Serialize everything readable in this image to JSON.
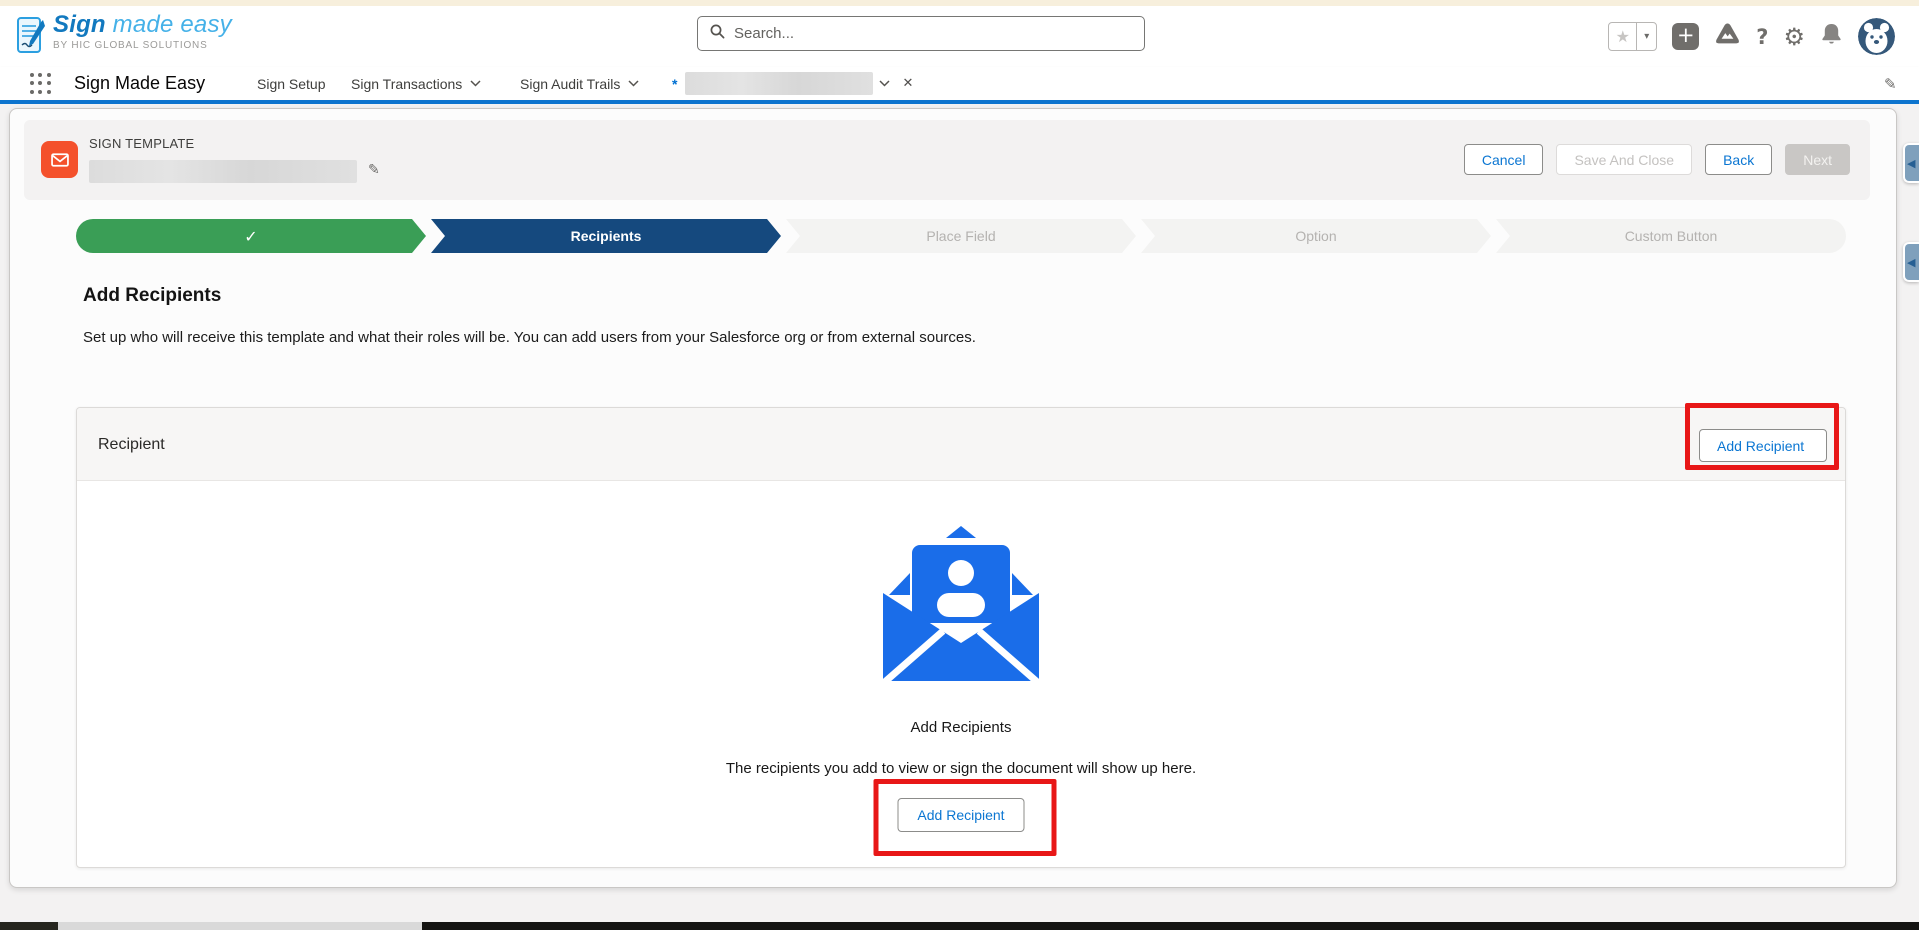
{
  "app": {
    "brand_bold": "Sign",
    "brand_light": " made easy",
    "brand_subtitle": "BY HIC GLOBAL SOLUTIONS",
    "app_name": "Sign Made Easy"
  },
  "header": {
    "search_placeholder": "Search..."
  },
  "glyphs": {
    "check": "✓",
    "star": "★",
    "caret_down": "▾",
    "plus": "+",
    "help": "?",
    "gear": "⚙",
    "close": "✕",
    "pencil": "✎",
    "toggle_left": "◀"
  },
  "nav": {
    "tabs": [
      {
        "label": "Sign Setup"
      },
      {
        "label": "Sign Transactions"
      },
      {
        "label": "Sign Audit Trails"
      }
    ],
    "active_tab": {
      "unsaved_indicator": "*"
    }
  },
  "page_header": {
    "record_type": "SIGN TEMPLATE",
    "actions": {
      "cancel": "Cancel",
      "save_and_close": "Save And Close",
      "back": "Back",
      "next": "Next"
    }
  },
  "stepper": {
    "steps": [
      "",
      "Recipients",
      "Place Field",
      "Option",
      "Custom Button"
    ]
  },
  "main": {
    "title": "Add Recipients",
    "subtitle": "Set up who will receive this template and what their roles will be. You can add users from your Salesforce org or from external sources."
  },
  "recipient_panel": {
    "header": "Recipient",
    "add_button": "Add Recipient",
    "empty_title": "Add Recipients",
    "empty_description": "The recipients you add to view or sign the document will show up here.",
    "empty_button": "Add Recipient"
  },
  "colors": {
    "accent_blue": "#0b76d2",
    "brand_orange": "#f4512c",
    "step_green": "#3a9e56",
    "step_navy": "#15497e",
    "illustration_blue": "#1a6de9",
    "annotation_red": "#e81717"
  }
}
